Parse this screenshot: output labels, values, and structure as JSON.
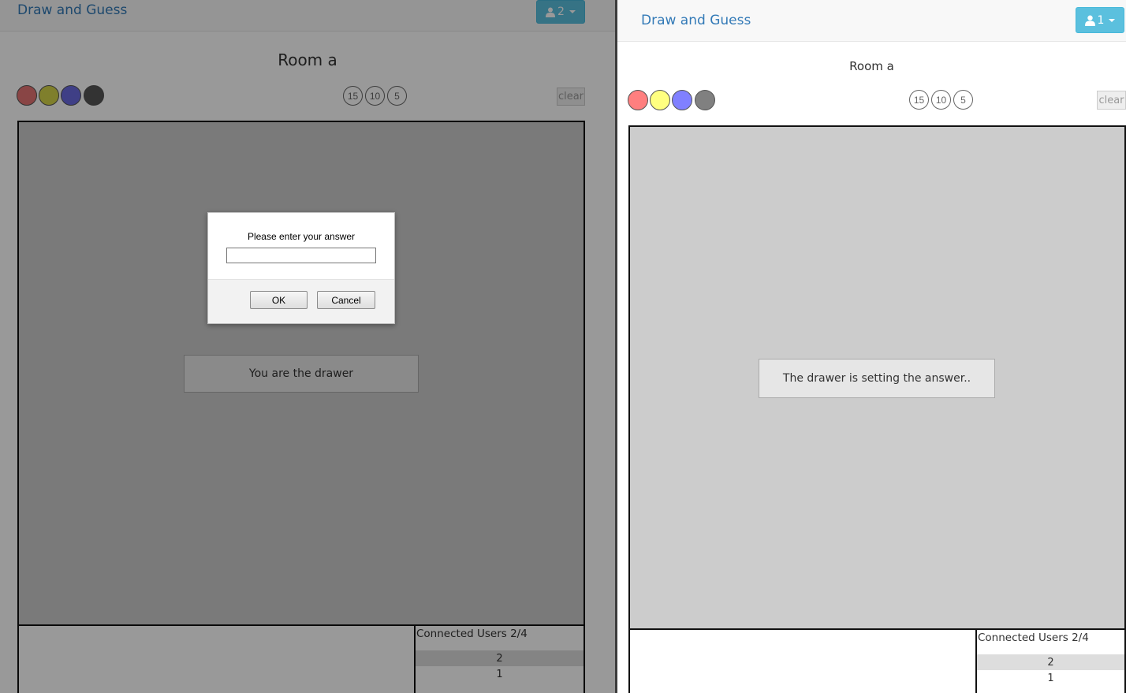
{
  "left": {
    "brand": "Draw and Guess",
    "user_count": "2",
    "room_title": "Room a",
    "colors": [
      "#e57373",
      "#d4d44a",
      "#6a6ae0",
      "#555555"
    ],
    "sizes": [
      "15",
      "10",
      "5"
    ],
    "clear_label": "clear",
    "status": "You are the drawer",
    "users_title": "Connected Users 2/4",
    "users": [
      "2",
      "1"
    ]
  },
  "right": {
    "brand": "Draw and Guess",
    "user_count": "1",
    "room_title": "Room a",
    "colors": [
      "#ff7f7f",
      "#ffff80",
      "#8080ff",
      "#808080"
    ],
    "sizes": [
      "15",
      "10",
      "5"
    ],
    "clear_label": "clear",
    "status": "The drawer is setting the answer..",
    "users_title": "Connected Users 2/4",
    "users": [
      "2",
      "1"
    ]
  },
  "dialog": {
    "message": "Please enter your answer",
    "input_value": "",
    "ok_label": "OK",
    "cancel_label": "Cancel"
  },
  "icons": {
    "user": "user-icon",
    "caret": "caret-down-icon"
  },
  "accent": "#5bc0de",
  "brand_color": "#337ab7"
}
